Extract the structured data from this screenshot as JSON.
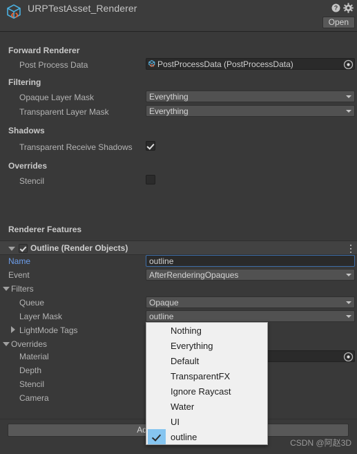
{
  "header": {
    "title": "URPTestAsset_Renderer",
    "open_label": "Open",
    "help_icon": "help-circle-icon",
    "settings_icon": "gear-icon",
    "asset_icon": "scriptable-object-cube-icon"
  },
  "forward_renderer": {
    "section_label": "Forward Renderer",
    "post_process_data": {
      "label": "Post Process Data",
      "value": "PostProcessData (PostProcessData)",
      "icon": "scriptable-object-small-icon",
      "picker_icon": "object-picker-icon"
    }
  },
  "filtering": {
    "section_label": "Filtering",
    "opaque_layer_mask": {
      "label": "Opaque Layer Mask",
      "value": "Everything"
    },
    "transparent_layer_mask": {
      "label": "Transparent Layer Mask",
      "value": "Everything"
    }
  },
  "shadows": {
    "section_label": "Shadows",
    "transparent_receive_shadows": {
      "label": "Transparent Receive Shadows",
      "checked": true
    }
  },
  "overrides_top": {
    "section_label": "Overrides",
    "stencil": {
      "label": "Stencil",
      "checked": false
    }
  },
  "renderer_features": {
    "section_label": "Renderer Features",
    "feature": {
      "title": "Outline (Render Objects)",
      "enabled": true,
      "menu_icon": "kebab-menu-icon",
      "foldout_icon": "foldout-open-icon",
      "name": {
        "label": "Name",
        "value": "outline"
      },
      "event": {
        "label": "Event",
        "value": "AfterRenderingOpaques"
      },
      "filters": {
        "label": "Filters",
        "queue": {
          "label": "Queue",
          "value": "Opaque"
        },
        "layer_mask": {
          "label": "Layer Mask",
          "value": "outline"
        },
        "lightmode_tags": {
          "label": "LightMode Tags"
        }
      },
      "overrides": {
        "label": "Overrides",
        "material": {
          "label": "Material",
          "value": "",
          "picker_icon": "object-picker-icon"
        },
        "depth": {
          "label": "Depth"
        },
        "stencil": {
          "label": "Stencil"
        },
        "camera": {
          "label": "Camera"
        }
      }
    },
    "add_button_label": "Add Renderer Feature"
  },
  "layer_popup": {
    "items": [
      {
        "label": "Nothing",
        "selected": false
      },
      {
        "label": "Everything",
        "selected": false
      },
      {
        "label": "Default",
        "selected": false
      },
      {
        "label": "TransparentFX",
        "selected": false
      },
      {
        "label": "Ignore Raycast",
        "selected": false
      },
      {
        "label": "Water",
        "selected": false
      },
      {
        "label": "UI",
        "selected": false
      },
      {
        "label": "outline",
        "selected": true
      }
    ]
  },
  "watermark": "CSDN @阿赵3D",
  "colors": {
    "window_bg": "#393939",
    "header_bg": "#3c3c3c",
    "accent_blue": "#6d9eeb",
    "focus_border": "#3e6ea8",
    "popup_bg": "#f0f0f0",
    "popup_highlight": "#86c5f0",
    "icon_cube": "#4bb0e0",
    "icon_braces": "#f26430"
  }
}
